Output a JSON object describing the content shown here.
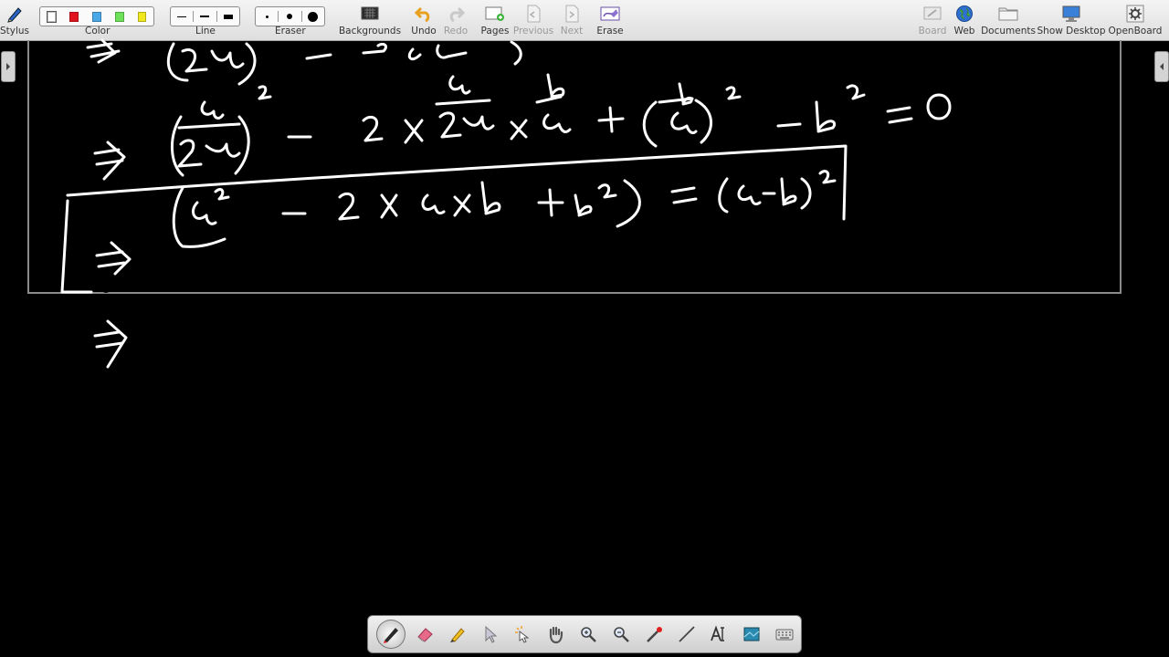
{
  "toolbar": {
    "stylus_label": "Stylus",
    "color_label": "Color",
    "line_label": "Line",
    "eraser_label": "Eraser",
    "backgrounds_label": "Backgrounds",
    "undo_label": "Undo",
    "redo_label": "Redo",
    "pages_label": "Pages",
    "previous_label": "Previous",
    "next_label": "Next",
    "erase_label": "Erase",
    "board_label": "Board",
    "web_label": "Web",
    "documents_label": "Documents",
    "show_desktop_label": "Show Desktop",
    "openboard_label": "OpenBoard"
  },
  "colors": [
    "#ffffff",
    "#e0141e",
    "#4aa8e6",
    "#6ee05a",
    "#f0e81e"
  ],
  "selected_color": "#ffffff",
  "palette_tools": [
    "pen-icon",
    "eraser-icon",
    "marker-icon",
    "selector-icon",
    "interact-icon",
    "hand-icon",
    "zoom-in-icon",
    "zoom-out-icon",
    "laser-pointer-icon",
    "line-icon",
    "text-icon",
    "capture-icon",
    "keyboard-icon"
  ]
}
